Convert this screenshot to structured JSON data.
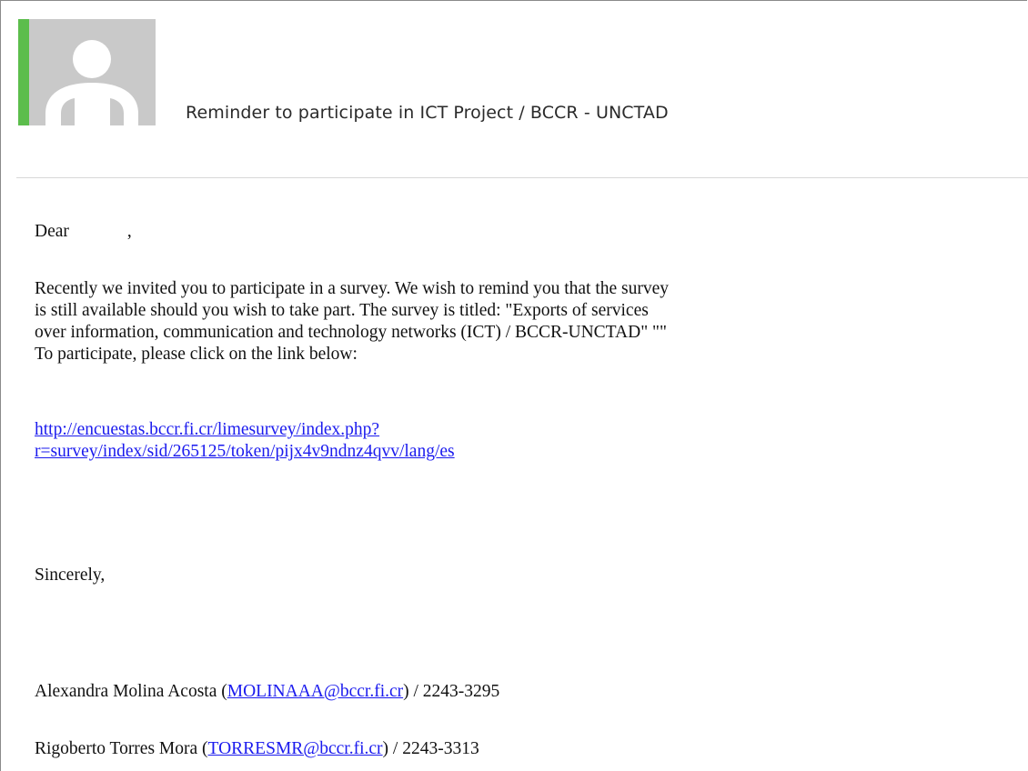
{
  "message": {
    "subject": "Reminder to participate in ICT Project / BCCR - UNCTAD",
    "greeting_word": "Dear",
    "greeting_comma": ",",
    "body_lines": [
      "Recently we invited you to participate in a survey. We wish to remind you that the survey",
      "is still available should you wish to take part. The survey is titled: \"Exports of services",
      "over information, communication and technology networks (ICT) / BCCR-UNCTAD\" \"\"",
      "To participate, please click on the link below:"
    ],
    "link_lines": [
      " http://encuestas.bccr.fi.cr/limesurvey/index.php?",
      "r=survey/index/sid/265125/token/pijx4v9ndnz4qvv/lang/es"
    ],
    "closing": "Sincerely,",
    "contacts": [
      {
        "name": "Alexandra Molina Acosta (",
        "email": "MOLINAAA@bccr.fi.cr",
        "suffix": ") / 2243-3295"
      },
      {
        "name": "Rigoberto Torres Mora (",
        "email": "TORRESMR@bccr.fi.cr",
        "suffix": ") / 2243-3313"
      }
    ]
  },
  "colors": {
    "accent": "#5cbd4c",
    "avatar_bg": "#c9c9c9",
    "link": "#1a1aee"
  },
  "icons": {
    "avatar": "person-silhouette-icon"
  }
}
